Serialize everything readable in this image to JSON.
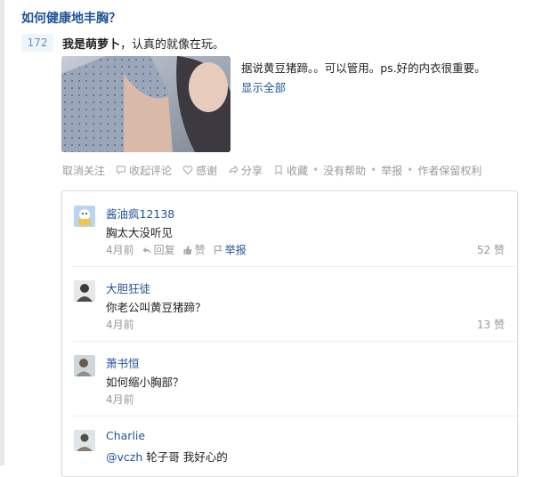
{
  "question": {
    "title": "如何健康地丰胸？"
  },
  "answer": {
    "votes": "172",
    "author_name": "我是萌萝卜",
    "author_bio": "，认真的就像在玩。",
    "excerpt": "据说黄豆猪蹄。。可以管用。ps.好的内衣很重要。",
    "show_all": "显示全部"
  },
  "actions": {
    "unfollow": "取消关注",
    "collapse_comments": "收起评论",
    "thanks": "感谢",
    "share": "分享",
    "collect": "收藏",
    "no_help": "没有帮助",
    "report": "举报",
    "copyright": "作者保留权利"
  },
  "comments": [
    {
      "name": "酱油疯12138",
      "text": "胸太大没听见",
      "time": "4月前",
      "reply": "回复",
      "like": "赞",
      "report": "举报",
      "likes": "52 赞"
    },
    {
      "name": "大胆狂徒",
      "text": "你老公叫黄豆猪蹄？",
      "time": "4月前",
      "likes": "13 赞"
    },
    {
      "name": "萧书恒",
      "text": "如何缩小胸部？",
      "time": "4月前"
    },
    {
      "name": "Charlie",
      "mention": "@vczh",
      "text": " 轮子哥 我好心的"
    }
  ],
  "colors": {
    "link": "#225599",
    "muted": "#999999",
    "vote_bg": "#eff6fa",
    "vote_fg": "#698ebf"
  },
  "icons": [
    "heart-icon",
    "comment-icon",
    "heart-icon",
    "share-icon",
    "bookmark-icon",
    "reply-icon",
    "thumbs-up-icon",
    "flag-icon"
  ]
}
